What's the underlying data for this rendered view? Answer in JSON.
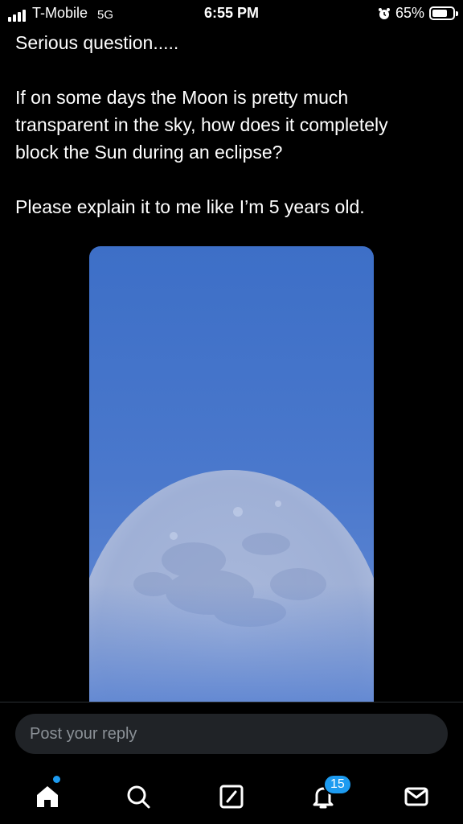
{
  "status_bar": {
    "carrier": "T-Mobile",
    "network": "5G",
    "time": "6:55 PM",
    "battery": "65%",
    "battery_level": 0.65
  },
  "post": {
    "line1": "Serious question.....",
    "paragraph2": "If on some days the Moon is pretty much transparent in the sky, how does it completely block the Sun during an eclipse?",
    "paragraph3": "Please explain it to me like I’m 5 years old."
  },
  "reply": {
    "placeholder": "Post your reply"
  },
  "tab_bar": {
    "items": [
      "home-icon",
      "search-icon",
      "compose-icon",
      "notifications-icon",
      "messages-icon"
    ],
    "notifications_badge": "15"
  },
  "colors": {
    "accent": "#1d9bf0",
    "sky": "#4a78cc",
    "background": "#000000"
  }
}
